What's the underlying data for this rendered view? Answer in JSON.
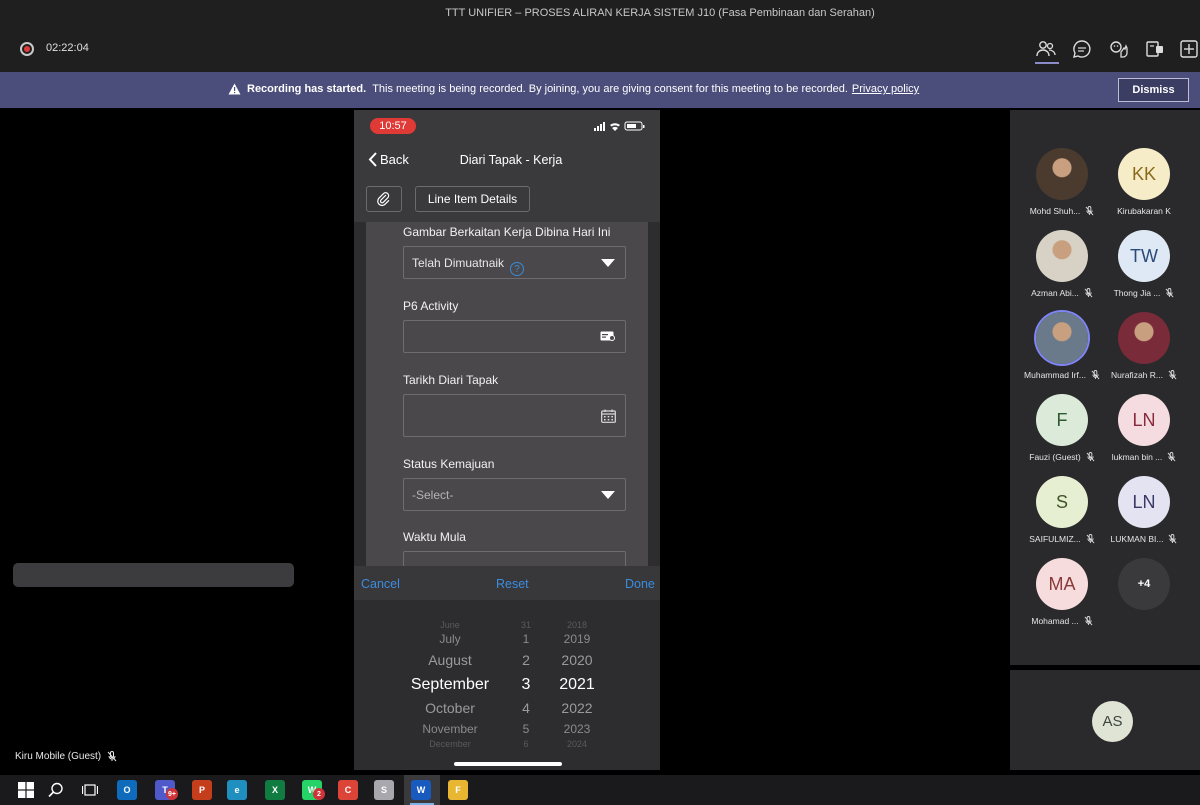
{
  "window": {
    "title": "TTT UNIFIER – PROSES ALIRAN KERJA SISTEM J10 (Fasa Pembinaan dan Serahan)"
  },
  "toolbar": {
    "timer": "02:22:04",
    "icons": [
      "record-icon",
      "people-icon",
      "chat-icon",
      "raise-hand-icon",
      "breakout-icon",
      "more-icon"
    ]
  },
  "banner": {
    "title": "Recording has started.",
    "message": "This meeting is being recorded. By joining, you are giving consent for this meeting to be recorded.",
    "link": "Privacy policy",
    "dismiss": "Dismiss"
  },
  "stage": {
    "presenter": "Kiru Mobile (Guest)"
  },
  "phone": {
    "time": "10:57",
    "back": "Back",
    "title": "Diari Tapak - Kerja",
    "line_item_button": "Line Item Details",
    "form": {
      "gambar_label": "Gambar Berkaitan Kerja Dibina Hari Ini",
      "gambar_value": "Telah Dimuatnaik",
      "p6_label": "P6 Activity",
      "p6_value": "",
      "tarikh_label": "Tarikh Diari Tapak",
      "tarikh_value": "",
      "status_label": "Status Kemajuan",
      "status_value": "-Select-",
      "waktu_label": "Waktu Mula"
    },
    "picker": {
      "cancel": "Cancel",
      "reset": "Reset",
      "done": "Done",
      "months": [
        "June",
        "July",
        "August",
        "September",
        "October",
        "November",
        "December"
      ],
      "days": [
        "31",
        "1",
        "2",
        "3",
        "4",
        "5",
        "6"
      ],
      "years": [
        "2018",
        "2019",
        "2020",
        "2021",
        "2022",
        "2023",
        "2024"
      ],
      "selected": {
        "month": "September",
        "day": "3",
        "year": "2021"
      }
    }
  },
  "participants": [
    {
      "name": "Mohd Shuh...",
      "initials": "",
      "photo": true,
      "muted": true
    },
    {
      "name": "Kirubakaran K",
      "initials": "KK",
      "bg": "#f6edc8",
      "fg": "#8a6a1c",
      "muted": false
    },
    {
      "name": "Azman Abi...",
      "initials": "",
      "photo": true,
      "muted": true
    },
    {
      "name": "Thong Jia ...",
      "initials": "TW",
      "bg": "#dfe9f6",
      "fg": "#2a4b7a",
      "muted": true
    },
    {
      "name": "Muhammad Irf...",
      "initials": "",
      "photo": true,
      "muted": true,
      "speaking": true
    },
    {
      "name": "Nurafizah R...",
      "initials": "",
      "photo": true,
      "muted": true
    },
    {
      "name": "Fauzi (Guest)",
      "initials": "F",
      "bg": "#dcebd9",
      "fg": "#2e5a33",
      "muted": true
    },
    {
      "name": "lukman bin ...",
      "initials": "LN",
      "bg": "#f4dce0",
      "fg": "#8a2b3b",
      "muted": true
    },
    {
      "name": "SAIFULMIZ...",
      "initials": "S",
      "bg": "#e7efd3",
      "fg": "#40562a",
      "muted": true
    },
    {
      "name": "LUKMAN BI...",
      "initials": "LN",
      "bg": "#e3e3f2",
      "fg": "#3a3a6a",
      "muted": true
    },
    {
      "name": "Mohamad ...",
      "initials": "MA",
      "bg": "#f6dcdc",
      "fg": "#8a3a3a",
      "muted": true
    },
    {
      "name": "",
      "initials": "+4",
      "bg": "#3a3a3c",
      "fg": "#ffffff",
      "muted": false
    }
  ],
  "self": {
    "initials": "AS"
  },
  "taskbar": {
    "items": [
      "windows-start",
      "search",
      "task-view",
      "outlook",
      "teams",
      "powerpoint",
      "edge",
      "excel",
      "whatsapp",
      "chrome",
      "snip",
      "word",
      "file-explorer"
    ],
    "teams_badge": "9+",
    "whatsapp_badge": "2"
  }
}
